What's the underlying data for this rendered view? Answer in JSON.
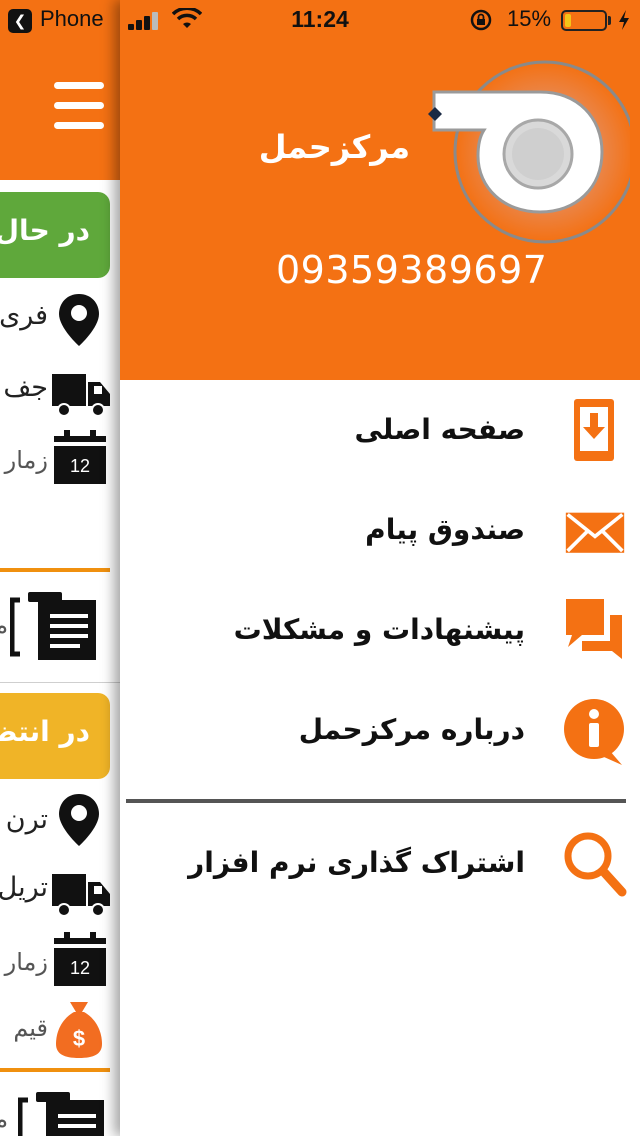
{
  "status_bar": {
    "back_app": "Phone",
    "time": "11:24",
    "battery_percent": "15%",
    "battery_level": 0.15,
    "icons": [
      "back-arrow-icon",
      "signal-icon",
      "wifi-icon",
      "rotation-lock-icon",
      "battery-icon",
      "charging-icon"
    ]
  },
  "main_screen": {
    "cards": [
      {
        "status": "در حال",
        "status_color": "#5fa83b",
        "rows": [
          {
            "icon": "location-pin-icon",
            "text": "فری"
          },
          {
            "icon": "truck-icon",
            "text": "جف"
          },
          {
            "icon": "calendar-icon",
            "calendar_day": "12",
            "text": "زمار"
          }
        ]
      },
      {
        "status": "در انتظا",
        "status_color": "#f0b427",
        "rows": [
          {
            "icon": "location-pin-icon",
            "text": "ترن"
          },
          {
            "icon": "truck-icon",
            "text": "تریل"
          },
          {
            "icon": "calendar-icon",
            "calendar_day": "12",
            "text": "زمار"
          },
          {
            "icon": "money-bag-icon",
            "text": "قیم"
          }
        ]
      }
    ],
    "clipboard_text": "م"
  },
  "drawer": {
    "brand_name": "مرکزحمل",
    "phone": "09359389697",
    "accent_color": "#f47113",
    "menu": [
      {
        "label": "صفحه اصلی",
        "icon": "home-download-icon"
      },
      {
        "label": "صندوق پیام",
        "icon": "envelope-icon"
      },
      {
        "label": "پیشنهادات و مشکلات",
        "icon": "chat-bubbles-icon"
      },
      {
        "label": "درباره مرکزحمل",
        "icon": "info-icon"
      }
    ],
    "share_label": "اشتراک گذاری نرم افزار",
    "share_icon": "search-icon"
  }
}
